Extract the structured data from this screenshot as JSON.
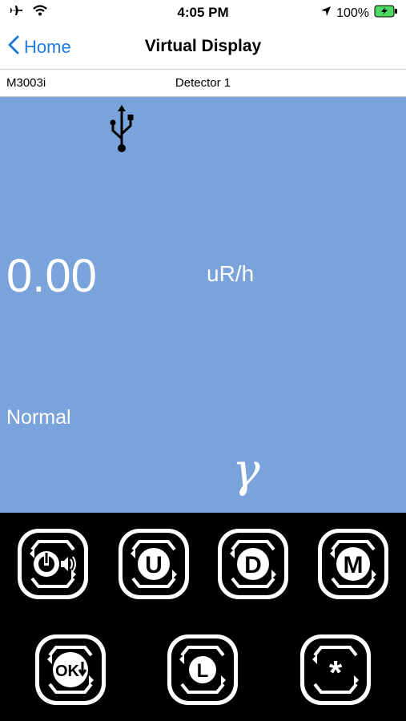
{
  "status_bar": {
    "time": "4:05 PM",
    "battery": "100%"
  },
  "nav": {
    "back_label": "Home",
    "title": "Virtual Display"
  },
  "device": {
    "model": "M3003i",
    "detector": "Detector 1"
  },
  "display": {
    "reading": "0.00",
    "unit": "uR/h",
    "state": "Normal",
    "symbol": "γ",
    "background_color": "#7aa2db"
  },
  "buttons": [
    {
      "id": "power-sound",
      "label": ""
    },
    {
      "id": "up",
      "label": "U"
    },
    {
      "id": "down",
      "label": "D"
    },
    {
      "id": "mode",
      "label": "M"
    },
    {
      "id": "ok",
      "label": "OK"
    },
    {
      "id": "light",
      "label": "L"
    },
    {
      "id": "star",
      "label": "*"
    }
  ]
}
